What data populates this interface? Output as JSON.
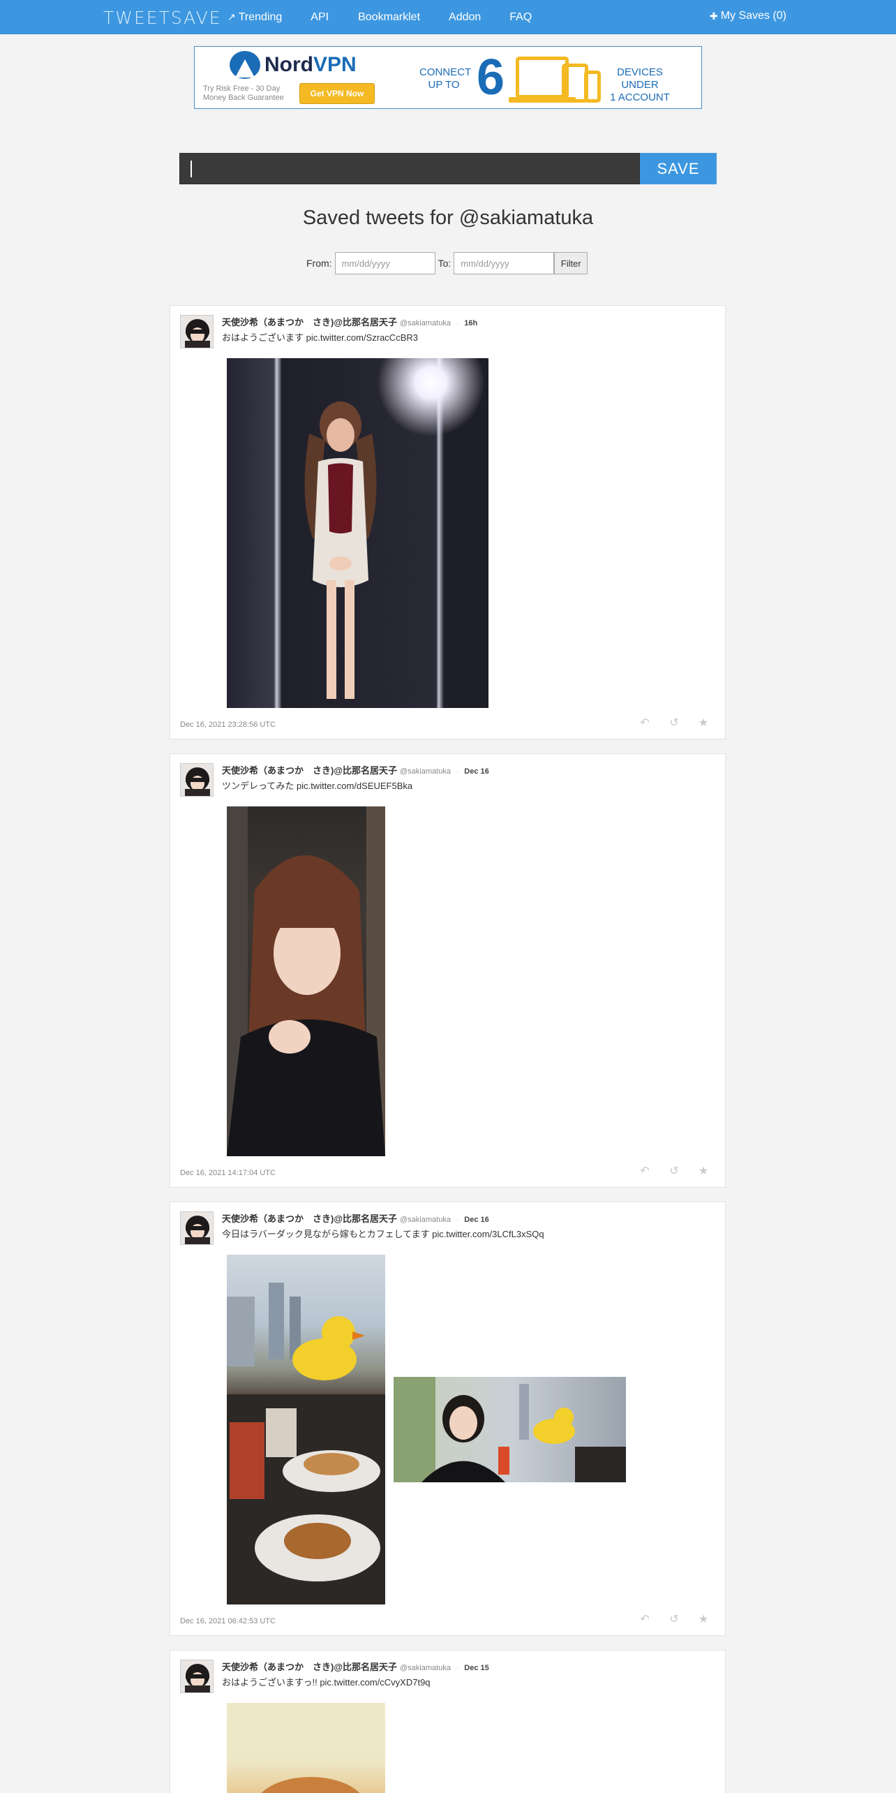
{
  "navbar": {
    "brand": "TWEETSAVE",
    "links": [
      {
        "label": "Trending",
        "icon": "trending-icon"
      },
      {
        "label": "API"
      },
      {
        "label": "Bookmarklet"
      },
      {
        "label": "Addon"
      },
      {
        "label": "FAQ"
      }
    ],
    "my_saves": "My Saves (0)",
    "my_saves_icon": "plus-circle-icon",
    "color": "#3d97e0"
  },
  "ad": {
    "brand_a": "Nord",
    "brand_b": "VPN",
    "tagline_1": "Try Risk Free - 30 Day",
    "tagline_2": "Money Back Guarantee",
    "button": "Get VPN Now",
    "connect_1": "CONNECT",
    "connect_2": "UP TO",
    "number": "6",
    "devices_1": "DEVICES UNDER",
    "devices_2": "1 ACCOUNT"
  },
  "save": {
    "input_value": "",
    "button": "SAVE"
  },
  "title": "Saved tweets for @sakiamatuka",
  "filter": {
    "from_label": "From:",
    "to_label": "To:",
    "from_placeholder": "mm/dd/yyyy",
    "to_placeholder": "mm/dd/yyyy",
    "button": "Filter"
  },
  "tweets": [
    {
      "name": "天使沙希（あまつか　さき)@比那名居天子",
      "handle": "@sakiamatuka",
      "time": "16h",
      "text": "おはようございます pic.twitter.com/SzracCcBR3",
      "date": "Dec 16, 2021 23:28:56 UTC"
    },
    {
      "name": "天使沙希（あまつか　さき)@比那名居天子",
      "handle": "@sakiamatuka",
      "time": "Dec 16",
      "text": "ツンデレってみた pic.twitter.com/dSEUEF5Bka",
      "date": "Dec 16, 2021 14:17:04 UTC"
    },
    {
      "name": "天使沙希（あまつか　さき)@比那名居天子",
      "handle": "@sakiamatuka",
      "time": "Dec 16",
      "text": "今日はラバーダック見ながら嫁もとカフェしてます pic.twitter.com/3LCfL3xSQq",
      "date": "Dec 16, 2021 06:42:53 UTC"
    },
    {
      "name": "天使沙希（あまつか　さき)@比那名居天子",
      "handle": "@sakiamatuka",
      "time": "Dec 15",
      "text": "おはようございますっ!! pic.twitter.com/cCvyXD7t9q",
      "date": ""
    }
  ],
  "actions": {
    "reply_icon": "reply-icon",
    "retweet_icon": "retweet-icon",
    "favorite_icon": "star-icon"
  }
}
